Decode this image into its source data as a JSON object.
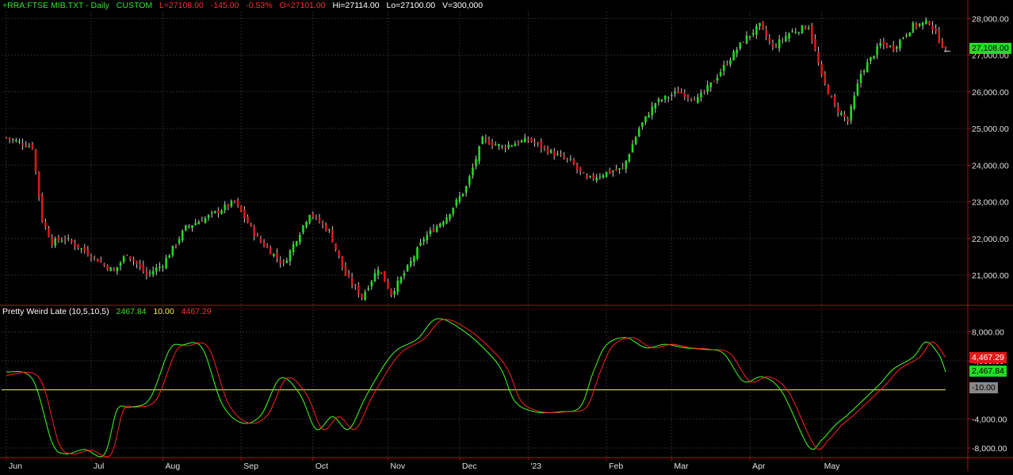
{
  "price_header": {
    "symbol_label": "+RRA:FTSE MIB.TXT - Daily",
    "custom_label": "CUSTOM",
    "last": "L=27108.00",
    "change": "-145.00",
    "change_pct": "-0.53%",
    "open": "O=27101.00",
    "high": "Hi=27114.00",
    "low": "Lo=27100.00",
    "volume": "V=300,000"
  },
  "indicator_header": {
    "name": "Pretty Weird Late (10,5,10,5)",
    "value_fast": "2467.84",
    "value_zero": "10.00",
    "value_slow": "4467.29"
  },
  "colors": {
    "background": "#000000",
    "grid": "#2a2a2a",
    "up": "#22dd22",
    "down": "#e01818",
    "fast_line": "#44ff22",
    "slow_line": "#ff2020",
    "zero_line": "#f0f080",
    "axis_border": "#b01010",
    "axis_text": "#e0e0e0",
    "header_green": "#2ee62e",
    "header_red": "#ff3030",
    "header_yellow": "#f0f050"
  },
  "chart_data": [
    {
      "type": "candlestick",
      "title": "+RRA:FTSE MIB.TXT - Daily",
      "yticks": [
        "21,000.00",
        "22,000.00",
        "23,000.00",
        "24,000.00",
        "25,000.00",
        "26,000.00",
        "27,000.00",
        "28,000.00"
      ],
      "ylim": [
        20200,
        28200
      ],
      "last_price_label": "27,108.00",
      "close_anchors": [
        {
          "d": 0,
          "v": 24750
        },
        {
          "d": 8,
          "v": 24500
        },
        {
          "d": 11,
          "v": 22500
        },
        {
          "d": 14,
          "v": 21900
        },
        {
          "d": 18,
          "v": 22000
        },
        {
          "d": 25,
          "v": 21600
        },
        {
          "d": 33,
          "v": 21100
        },
        {
          "d": 37,
          "v": 21600
        },
        {
          "d": 43,
          "v": 21000
        },
        {
          "d": 48,
          "v": 21300
        },
        {
          "d": 55,
          "v": 22300
        },
        {
          "d": 62,
          "v": 22600
        },
        {
          "d": 70,
          "v": 23000
        },
        {
          "d": 77,
          "v": 22000
        },
        {
          "d": 85,
          "v": 21300
        },
        {
          "d": 93,
          "v": 22700
        },
        {
          "d": 99,
          "v": 22200
        },
        {
          "d": 104,
          "v": 21000
        },
        {
          "d": 109,
          "v": 20400
        },
        {
          "d": 114,
          "v": 21200
        },
        {
          "d": 118,
          "v": 20500
        },
        {
          "d": 123,
          "v": 21200
        },
        {
          "d": 128,
          "v": 22000
        },
        {
          "d": 135,
          "v": 22600
        },
        {
          "d": 141,
          "v": 23400
        },
        {
          "d": 146,
          "v": 24700
        },
        {
          "d": 152,
          "v": 24500
        },
        {
          "d": 160,
          "v": 24700
        },
        {
          "d": 168,
          "v": 24300
        },
        {
          "d": 173,
          "v": 24100
        },
        {
          "d": 178,
          "v": 23600
        },
        {
          "d": 184,
          "v": 23800
        },
        {
          "d": 189,
          "v": 23900
        },
        {
          "d": 194,
          "v": 25000
        },
        {
          "d": 199,
          "v": 25700
        },
        {
          "d": 206,
          "v": 26000
        },
        {
          "d": 212,
          "v": 25800
        },
        {
          "d": 216,
          "v": 26200
        },
        {
          "d": 221,
          "v": 26800
        },
        {
          "d": 226,
          "v": 27400
        },
        {
          "d": 231,
          "v": 27800
        },
        {
          "d": 235,
          "v": 27200
        },
        {
          "d": 240,
          "v": 27600
        },
        {
          "d": 246,
          "v": 27800
        },
        {
          "d": 250,
          "v": 26400
        },
        {
          "d": 254,
          "v": 25600
        },
        {
          "d": 258,
          "v": 25200
        },
        {
          "d": 262,
          "v": 26500
        },
        {
          "d": 268,
          "v": 27300
        },
        {
          "d": 272,
          "v": 27200
        },
        {
          "d": 278,
          "v": 27800
        },
        {
          "d": 283,
          "v": 27900
        },
        {
          "d": 288,
          "v": 27108
        }
      ]
    },
    {
      "type": "line",
      "title": "Pretty Weird Late (10,5,10,5)",
      "yticks": [
        "8,000.00",
        "4,000.00",
        "-4,000.00",
        "-8,000.00"
      ],
      "ylim": [
        -9200,
        9800
      ],
      "zero_value": 10,
      "value_labels": {
        "slow": "4,467.29",
        "fast": "2,467.84",
        "zero": "-10.00"
      },
      "series": [
        {
          "key": "fast",
          "x": [
            0,
            8,
            14,
            18,
            24,
            30,
            34,
            38,
            44,
            50,
            54,
            60,
            66,
            72,
            78,
            84,
            90,
            95,
            100,
            105,
            110,
            116,
            120,
            126,
            132,
            140,
            148,
            152,
            156,
            162,
            170,
            176,
            180,
            184,
            190,
            196,
            202,
            208,
            214,
            220,
            226,
            232,
            238,
            246,
            250,
            254,
            258,
            262,
            268,
            272,
            278,
            282,
            286,
            288
          ],
          "y": [
            2500,
            1500,
            -7200,
            -8800,
            -8200,
            -8900,
            -2700,
            -2400,
            -1200,
            5500,
            6200,
            5800,
            -1800,
            -4500,
            -3500,
            1600,
            -600,
            -5400,
            -3700,
            -5400,
            -1100,
            3500,
            5600,
            7000,
            9800,
            8200,
            5000,
            2600,
            -1600,
            -3000,
            -3000,
            -2300,
            2500,
            6200,
            7200,
            5800,
            6300,
            5800,
            5600,
            5000,
            1200,
            1800,
            -400,
            -7800,
            -6900,
            -4900,
            -3400,
            -1700,
            900,
            2900,
            4500,
            6600,
            4800,
            2468
          ]
        },
        {
          "key": "slow",
          "x": [
            0,
            10,
            16,
            20,
            26,
            32,
            36,
            40,
            46,
            52,
            56,
            62,
            68,
            74,
            80,
            86,
            92,
            97,
            102,
            107,
            112,
            118,
            122,
            128,
            134,
            142,
            150,
            154,
            158,
            164,
            172,
            178,
            182,
            186,
            192,
            198,
            204,
            210,
            216,
            222,
            228,
            234,
            240,
            248,
            252,
            256,
            260,
            264,
            270,
            274,
            280,
            284,
            288
          ],
          "y": [
            2000,
            1700,
            -7200,
            -8800,
            -8300,
            -8900,
            -2700,
            -2400,
            -1300,
            5300,
            6100,
            5800,
            -1800,
            -4500,
            -3500,
            1600,
            -600,
            -5400,
            -3700,
            -5400,
            -1100,
            3400,
            5500,
            7000,
            9700,
            8200,
            5000,
            2600,
            -1600,
            -3000,
            -3000,
            -2300,
            2400,
            6100,
            7200,
            5800,
            6300,
            5800,
            5600,
            5000,
            1200,
            1800,
            -400,
            -7800,
            -6900,
            -4900,
            -3400,
            -1700,
            900,
            2900,
            4500,
            6600,
            4467
          ]
        }
      ]
    }
  ],
  "x_axis": {
    "labels": [
      {
        "text": "Jun",
        "d": 0
      },
      {
        "text": "Jul",
        "d": 26
      },
      {
        "text": "Aug",
        "d": 48
      },
      {
        "text": "Sep",
        "d": 72
      },
      {
        "text": "Oct",
        "d": 94
      },
      {
        "text": "Nov",
        "d": 117
      },
      {
        "text": "Dec",
        "d": 139
      },
      {
        "text": "'23",
        "d": 160
      },
      {
        "text": "Feb",
        "d": 184
      },
      {
        "text": "Mar",
        "d": 204
      },
      {
        "text": "Apr",
        "d": 228
      },
      {
        "text": "May",
        "d": 250
      }
    ]
  }
}
